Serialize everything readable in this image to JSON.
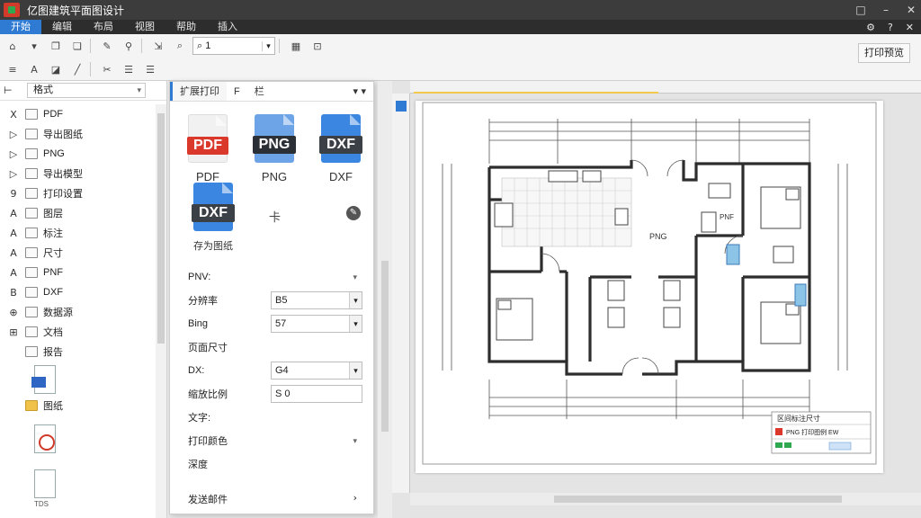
{
  "app": {
    "title": "亿图建筑平面图设计"
  },
  "window_controls": [
    "□",
    "–",
    "✕"
  ],
  "menu": {
    "items": [
      "开始",
      "编辑",
      "布局",
      "视图",
      "帮助",
      "插入"
    ],
    "active_index": 0,
    "right": [
      "⚙",
      "?",
      "✕"
    ]
  },
  "toolbar": {
    "zoom_value": "1",
    "right_button": "打印预览"
  },
  "sidebar": {
    "select_value": "格式",
    "items": [
      {
        "prefix": "X",
        "label": "PDF"
      },
      {
        "prefix": "▷",
        "label": "导出图纸"
      },
      {
        "prefix": "▷",
        "label": "PNG"
      },
      {
        "prefix": "▷",
        "label": "导出模型"
      },
      {
        "prefix": "9",
        "label": "打印设置"
      },
      {
        "prefix": "A",
        "label": "图层"
      },
      {
        "prefix": "A",
        "label": "标注"
      },
      {
        "prefix": "A",
        "label": "尺寸"
      },
      {
        "prefix": "A",
        "label": "PNF"
      },
      {
        "prefix": "B",
        "label": "DXF"
      },
      {
        "prefix": "⊕",
        "label": "数据源"
      },
      {
        "prefix": "⊞",
        "label": "文档"
      },
      {
        "prefix": "",
        "label": "报告"
      },
      {
        "prefix": "",
        "label": "图纸"
      }
    ],
    "file_caption": "TDS"
  },
  "panel": {
    "tab_active": "扩展打印",
    "tab_2": "F",
    "tab_3": "栏",
    "tab_right": "▾ ▾",
    "formats": [
      {
        "tag": "PDF",
        "label": "PDF"
      },
      {
        "tag": "PNG",
        "label": "PNG"
      },
      {
        "tag": "DXF",
        "label": "DXF"
      }
    ],
    "format4_tag": "DXF",
    "format4_label": "存为图纸",
    "extra_text": "卡",
    "form": [
      {
        "label": "PNV:",
        "value": ""
      },
      {
        "label": "分辨率",
        "value": "B5"
      },
      {
        "label": "Bing",
        "value": "57"
      },
      {
        "label": "页面尺寸",
        "value": ""
      },
      {
        "label": "DX:",
        "value": "G4"
      },
      {
        "label": "缩放比例",
        "value": "S 0"
      },
      {
        "label": "文字:",
        "value": ""
      },
      {
        "label": "打印颜色",
        "value": ""
      },
      {
        "label": "深度",
        "value": ""
      }
    ],
    "bottom_label": "发送邮件"
  },
  "plan": {
    "room_labels": [
      "PNG",
      "PNF"
    ],
    "legend_line1": "区间标注尺寸",
    "legend_line2": "PNG 打印图例 EW"
  },
  "colors": {
    "accent": "#2f7bd4",
    "titlebar": "#3c3c3c",
    "pdf_red": "#d9382b",
    "wall": "#2d2d2d"
  }
}
